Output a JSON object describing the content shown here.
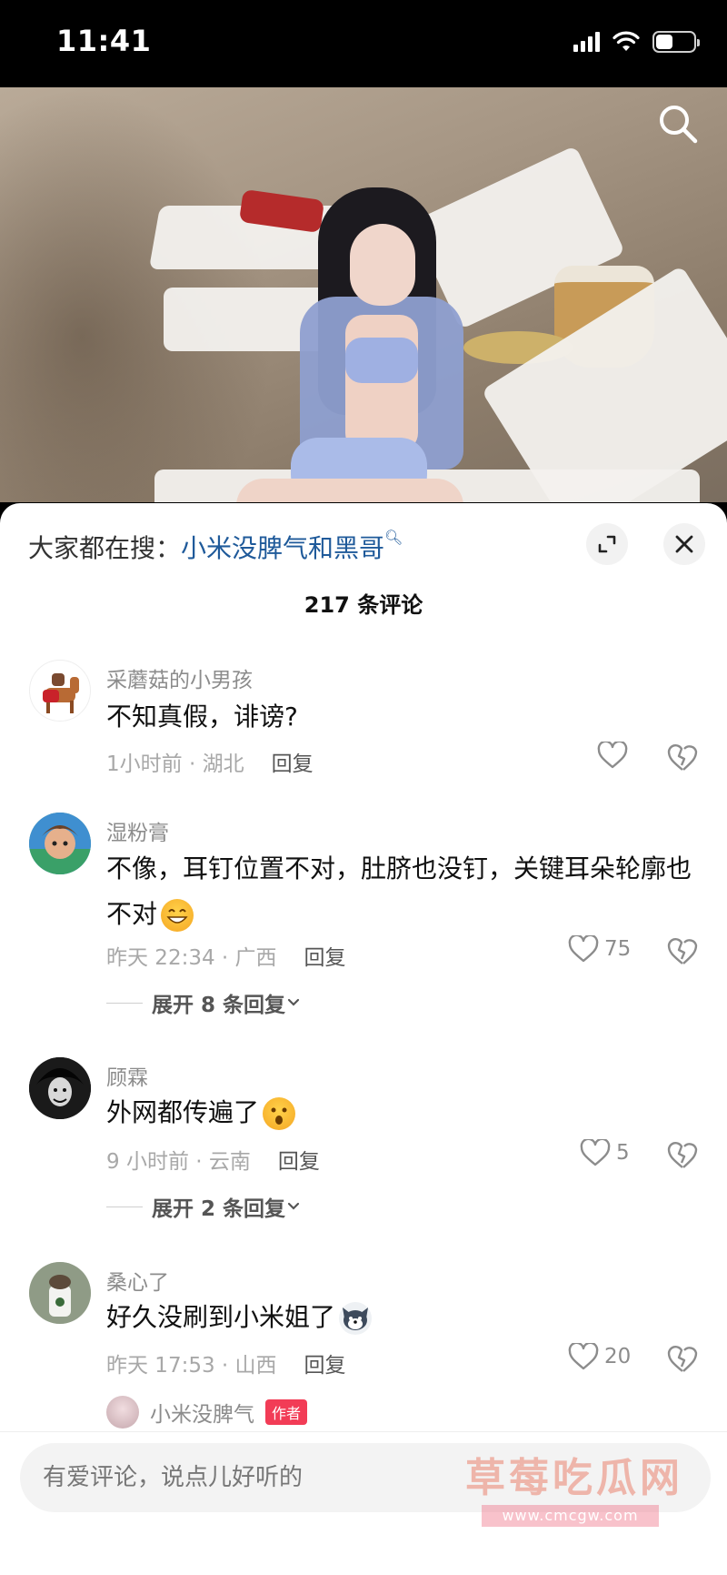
{
  "status_bar": {
    "time": "11:41"
  },
  "search_hint": {
    "prefix": "大家都在搜：",
    "term": "小米没脾气和黑哥"
  },
  "comments_header": {
    "count_label": "217 条评论"
  },
  "comments": [
    {
      "username": "采蘑菇的小男孩",
      "text": "不知真假，诽谤?",
      "meta": "1小时前 · 湖北",
      "reply_label": "回复",
      "likes": ""
    },
    {
      "username": "湿粉膏",
      "text": "不像，耳钉位置不对，肚脐也没钉，关键耳朵轮廓也不对",
      "meta": "昨天 22:34 · 广西",
      "reply_label": "回复",
      "likes": "75",
      "expand_label": "展开 8 条回复"
    },
    {
      "username": "顾霖",
      "text": "外网都传遍了",
      "meta": "9 小时前 · 云南",
      "reply_label": "回复",
      "likes": "5",
      "expand_label": "展开 2 条回复"
    },
    {
      "username": "桑心了",
      "text": "好久没刷到小米姐了",
      "meta": "昨天 17:53 · 山西",
      "reply_label": "回复",
      "likes": "20"
    }
  ],
  "author_reply": {
    "username": "小米没脾气",
    "badge": "作者"
  },
  "input": {
    "placeholder": "有爱评论，说点儿好听的"
  },
  "watermark": {
    "text": "草莓吃瓜网",
    "url": "www.cmcgw.com"
  },
  "colors": {
    "accent_link": "#1f5a9a",
    "author_badge": "#f23c56"
  }
}
